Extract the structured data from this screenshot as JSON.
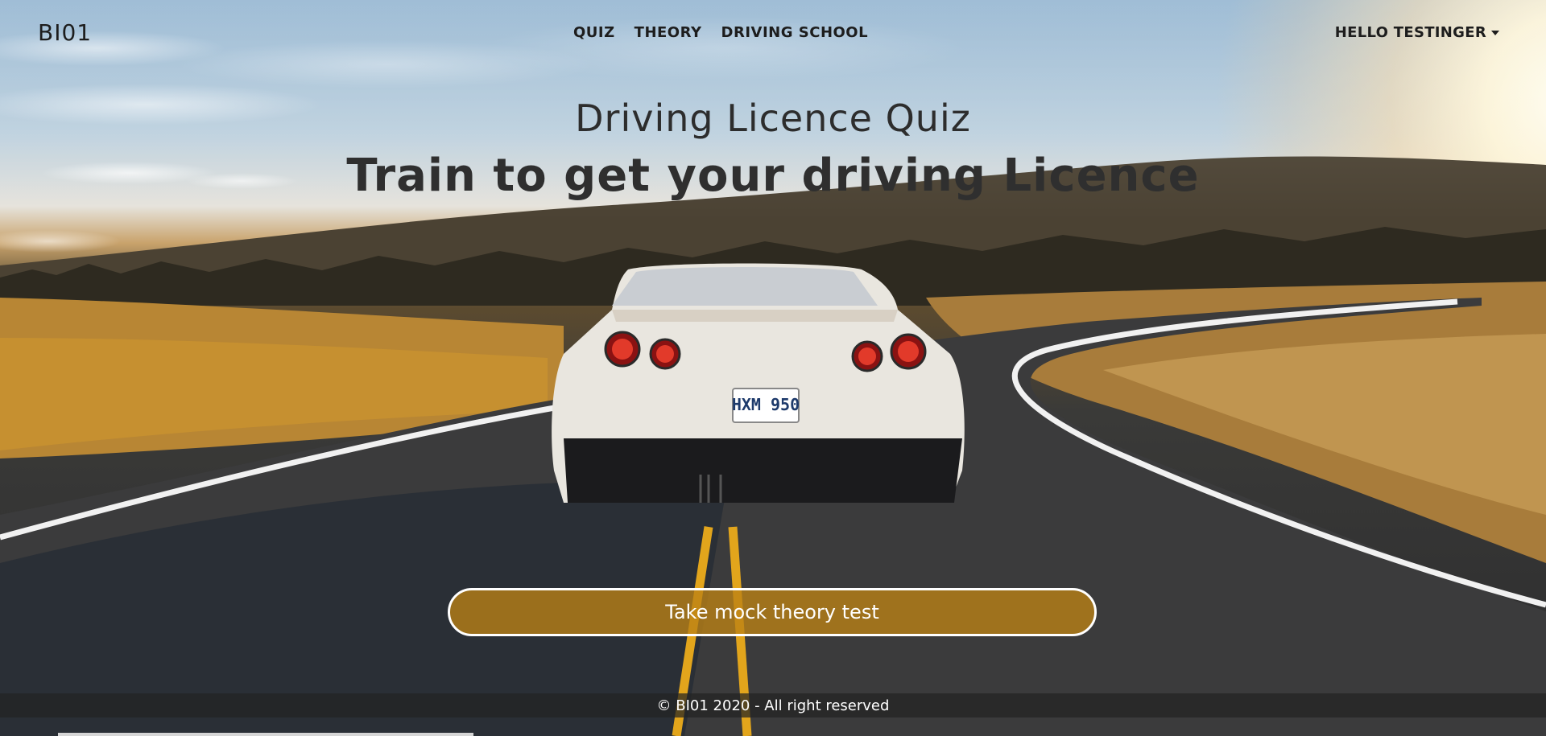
{
  "brand": "BI01",
  "nav": {
    "links": [
      "QUIZ",
      "THEORY",
      "DRIVING SCHOOL"
    ],
    "user": "HELLO TESTINGER"
  },
  "hero": {
    "subtitle": "Driving Licence Quiz",
    "title": "Train to get your driving Licence",
    "cta_label": "Take mock theory test",
    "license_plate": "HXM 950"
  },
  "footer": {
    "text": "© BI01 2020 - All right reserved"
  },
  "colors": {
    "cta_fill": "#bb8214",
    "text_dark": "#1d1d1d"
  }
}
